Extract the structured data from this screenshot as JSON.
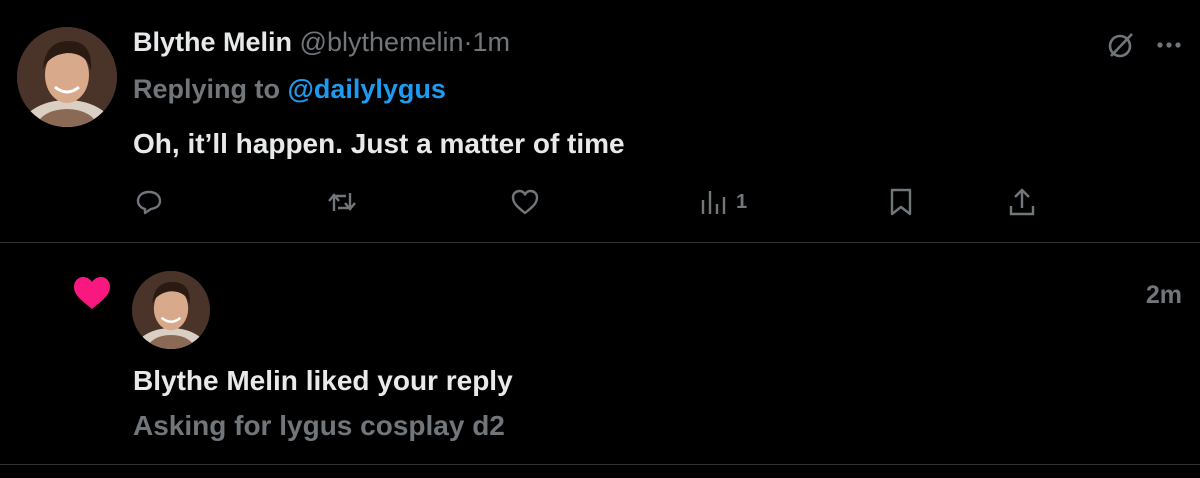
{
  "tweet": {
    "display_name": "Blythe Melin",
    "handle": "@blythemelin",
    "separator": "·",
    "time": "1m",
    "replying_prefix": "Replying to",
    "replying_to": "@dailylygus",
    "text": "Oh, it’ll happen. Just a matter of time",
    "icons": {
      "top": [
        "grok-icon",
        "more-icon"
      ],
      "actions": [
        "reply-icon",
        "retweet-icon",
        "like-icon",
        "views-icon",
        "bookmark-icon",
        "share-icon"
      ]
    },
    "views_count": "1"
  },
  "notification": {
    "icon": "heart-icon",
    "time": "2m",
    "title": "Blythe Melin liked your reply",
    "subtitle": "Asking for lygus cosplay d2"
  },
  "colors": {
    "background": "#000000",
    "text_primary": "#e7e9ea",
    "text_secondary": "#71767b",
    "accent": "#1d9bf0",
    "like_pink": "#f91880",
    "divider": "#2f3336"
  }
}
